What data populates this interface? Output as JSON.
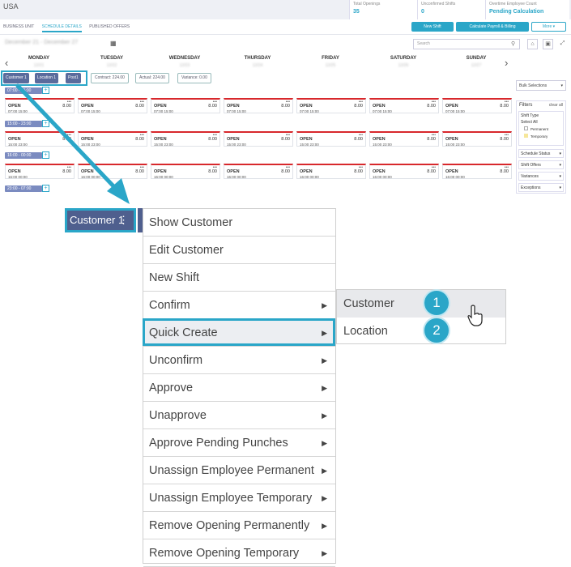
{
  "header": {
    "country": "USA",
    "stats": [
      {
        "label": "Total Openings",
        "value": "35"
      },
      {
        "label": "Unconfirmed Shifts",
        "value": "0"
      },
      {
        "label": "Overtime Employee Count",
        "value": "Pending Calculation"
      }
    ]
  },
  "tabs": [
    "BUSINESS UNIT",
    "SCHEDULE DETAILS",
    "PUBLISHED OFFERS"
  ],
  "actions": {
    "new_shift": "New Shift",
    "calc": "Calculate Payroll & Billing",
    "more": "More ▾"
  },
  "toolbar": {
    "date_range": "December 21 - December 27",
    "search_placeholder": "Search"
  },
  "days": [
    "MONDAY",
    "TUESDAY",
    "WEDNESDAY",
    "THURSDAY",
    "FRIDAY",
    "SATURDAY",
    "SUNDAY"
  ],
  "filters": {
    "chips": [
      "Customer 1",
      "Location 1",
      "Post1"
    ],
    "contract": "Contract: 224.00",
    "actual": "Actual: 224.00",
    "variance": "Variance: 0.00"
  },
  "rows": [
    {
      "label": "07:00 - 15:00",
      "time": "07:00 15:00"
    },
    {
      "label": "15:00 - 23:00",
      "time": "15:00 23:00"
    },
    {
      "label": "16:00 - 00:00",
      "time": "16:00 00:00"
    },
    {
      "label": "23:00 - 07:00",
      "time": ""
    }
  ],
  "row_times": [
    [
      "07:00 15:00",
      "07:00 15:00",
      "07:00 15:00",
      "07:00 15:00",
      "07:00 15:00",
      "07:00 15:00",
      "07:00 15:00"
    ],
    [
      "15:00 23:00",
      "15:00 23:00",
      "15:00 23:00",
      "15:00 23:00",
      "15:00 23:00",
      "15:00 23:00",
      "15:00 23:00"
    ],
    [
      "16:00 00:00",
      "16:00 00:00",
      "16:00 00:00",
      "16:00 00:00",
      "16:00 00:00",
      "16:00 00:00",
      "16:00 00:00"
    ]
  ],
  "card": {
    "status": "OPEN",
    "hours": "8.00",
    "dots": "•••"
  },
  "sidebar": {
    "bulk": "Bulk Selections",
    "filters_title": "Filters",
    "clear_all": "clear all",
    "shift_type": "Shift Type",
    "select_all": "Select All",
    "permanent": "Permanent",
    "temporary": "Temporary",
    "sections": [
      "Schedule Status",
      "Shift Offers",
      "Variances",
      "Exceptions"
    ]
  },
  "customer_button": {
    "label": "Customer 1"
  },
  "context_menu": [
    {
      "label": "Show Customer",
      "submenu": false
    },
    {
      "label": "Edit Customer",
      "submenu": false
    },
    {
      "label": "New Shift",
      "submenu": false
    },
    {
      "label": "Confirm",
      "submenu": true
    },
    {
      "label": "Quick Create",
      "submenu": true
    },
    {
      "label": "Unconfirm",
      "submenu": true
    },
    {
      "label": "Approve",
      "submenu": true
    },
    {
      "label": "Unapprove",
      "submenu": true
    },
    {
      "label": "Approve Pending Punches",
      "submenu": true
    },
    {
      "label": "Unassign Employee Permanent",
      "submenu": true
    },
    {
      "label": "Unassign Employee Temporary",
      "submenu": true
    },
    {
      "label": "Remove Opening Permanently",
      "submenu": true
    },
    {
      "label": "Remove Opening Temporary",
      "submenu": true
    }
  ],
  "submenu": [
    {
      "label": "Customer",
      "badge": "1"
    },
    {
      "label": "Location",
      "badge": "2"
    }
  ],
  "colors": {
    "accent": "#2aa6c8",
    "chip": "#5a6b9c",
    "open_border": "#d8282c"
  }
}
